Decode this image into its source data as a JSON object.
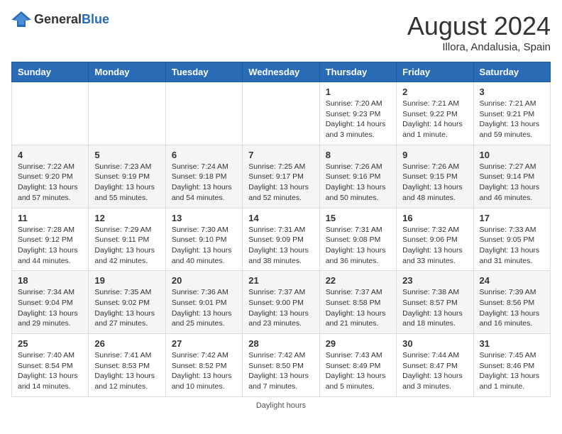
{
  "header": {
    "logo_general": "General",
    "logo_blue": "Blue",
    "month_year": "August 2024",
    "location": "Illora, Andalusia, Spain"
  },
  "days_of_week": [
    "Sunday",
    "Monday",
    "Tuesday",
    "Wednesday",
    "Thursday",
    "Friday",
    "Saturday"
  ],
  "footer": {
    "note": "Daylight hours"
  },
  "weeks": [
    {
      "days": [
        {
          "number": "",
          "info": ""
        },
        {
          "number": "",
          "info": ""
        },
        {
          "number": "",
          "info": ""
        },
        {
          "number": "",
          "info": ""
        },
        {
          "number": "1",
          "info": "Sunrise: 7:20 AM\nSunset: 9:23 PM\nDaylight: 14 hours\nand 3 minutes."
        },
        {
          "number": "2",
          "info": "Sunrise: 7:21 AM\nSunset: 9:22 PM\nDaylight: 14 hours\nand 1 minute."
        },
        {
          "number": "3",
          "info": "Sunrise: 7:21 AM\nSunset: 9:21 PM\nDaylight: 13 hours\nand 59 minutes."
        }
      ]
    },
    {
      "days": [
        {
          "number": "4",
          "info": "Sunrise: 7:22 AM\nSunset: 9:20 PM\nDaylight: 13 hours\nand 57 minutes."
        },
        {
          "number": "5",
          "info": "Sunrise: 7:23 AM\nSunset: 9:19 PM\nDaylight: 13 hours\nand 55 minutes."
        },
        {
          "number": "6",
          "info": "Sunrise: 7:24 AM\nSunset: 9:18 PM\nDaylight: 13 hours\nand 54 minutes."
        },
        {
          "number": "7",
          "info": "Sunrise: 7:25 AM\nSunset: 9:17 PM\nDaylight: 13 hours\nand 52 minutes."
        },
        {
          "number": "8",
          "info": "Sunrise: 7:26 AM\nSunset: 9:16 PM\nDaylight: 13 hours\nand 50 minutes."
        },
        {
          "number": "9",
          "info": "Sunrise: 7:26 AM\nSunset: 9:15 PM\nDaylight: 13 hours\nand 48 minutes."
        },
        {
          "number": "10",
          "info": "Sunrise: 7:27 AM\nSunset: 9:14 PM\nDaylight: 13 hours\nand 46 minutes."
        }
      ]
    },
    {
      "days": [
        {
          "number": "11",
          "info": "Sunrise: 7:28 AM\nSunset: 9:12 PM\nDaylight: 13 hours\nand 44 minutes."
        },
        {
          "number": "12",
          "info": "Sunrise: 7:29 AM\nSunset: 9:11 PM\nDaylight: 13 hours\nand 42 minutes."
        },
        {
          "number": "13",
          "info": "Sunrise: 7:30 AM\nSunset: 9:10 PM\nDaylight: 13 hours\nand 40 minutes."
        },
        {
          "number": "14",
          "info": "Sunrise: 7:31 AM\nSunset: 9:09 PM\nDaylight: 13 hours\nand 38 minutes."
        },
        {
          "number": "15",
          "info": "Sunrise: 7:31 AM\nSunset: 9:08 PM\nDaylight: 13 hours\nand 36 minutes."
        },
        {
          "number": "16",
          "info": "Sunrise: 7:32 AM\nSunset: 9:06 PM\nDaylight: 13 hours\nand 33 minutes."
        },
        {
          "number": "17",
          "info": "Sunrise: 7:33 AM\nSunset: 9:05 PM\nDaylight: 13 hours\nand 31 minutes."
        }
      ]
    },
    {
      "days": [
        {
          "number": "18",
          "info": "Sunrise: 7:34 AM\nSunset: 9:04 PM\nDaylight: 13 hours\nand 29 minutes."
        },
        {
          "number": "19",
          "info": "Sunrise: 7:35 AM\nSunset: 9:02 PM\nDaylight: 13 hours\nand 27 minutes."
        },
        {
          "number": "20",
          "info": "Sunrise: 7:36 AM\nSunset: 9:01 PM\nDaylight: 13 hours\nand 25 minutes."
        },
        {
          "number": "21",
          "info": "Sunrise: 7:37 AM\nSunset: 9:00 PM\nDaylight: 13 hours\nand 23 minutes."
        },
        {
          "number": "22",
          "info": "Sunrise: 7:37 AM\nSunset: 8:58 PM\nDaylight: 13 hours\nand 21 minutes."
        },
        {
          "number": "23",
          "info": "Sunrise: 7:38 AM\nSunset: 8:57 PM\nDaylight: 13 hours\nand 18 minutes."
        },
        {
          "number": "24",
          "info": "Sunrise: 7:39 AM\nSunset: 8:56 PM\nDaylight: 13 hours\nand 16 minutes."
        }
      ]
    },
    {
      "days": [
        {
          "number": "25",
          "info": "Sunrise: 7:40 AM\nSunset: 8:54 PM\nDaylight: 13 hours\nand 14 minutes."
        },
        {
          "number": "26",
          "info": "Sunrise: 7:41 AM\nSunset: 8:53 PM\nDaylight: 13 hours\nand 12 minutes."
        },
        {
          "number": "27",
          "info": "Sunrise: 7:42 AM\nSunset: 8:52 PM\nDaylight: 13 hours\nand 10 minutes."
        },
        {
          "number": "28",
          "info": "Sunrise: 7:42 AM\nSunset: 8:50 PM\nDaylight: 13 hours\nand 7 minutes."
        },
        {
          "number": "29",
          "info": "Sunrise: 7:43 AM\nSunset: 8:49 PM\nDaylight: 13 hours\nand 5 minutes."
        },
        {
          "number": "30",
          "info": "Sunrise: 7:44 AM\nSunset: 8:47 PM\nDaylight: 13 hours\nand 3 minutes."
        },
        {
          "number": "31",
          "info": "Sunrise: 7:45 AM\nSunset: 8:46 PM\nDaylight: 13 hours\nand 1 minute."
        }
      ]
    }
  ]
}
